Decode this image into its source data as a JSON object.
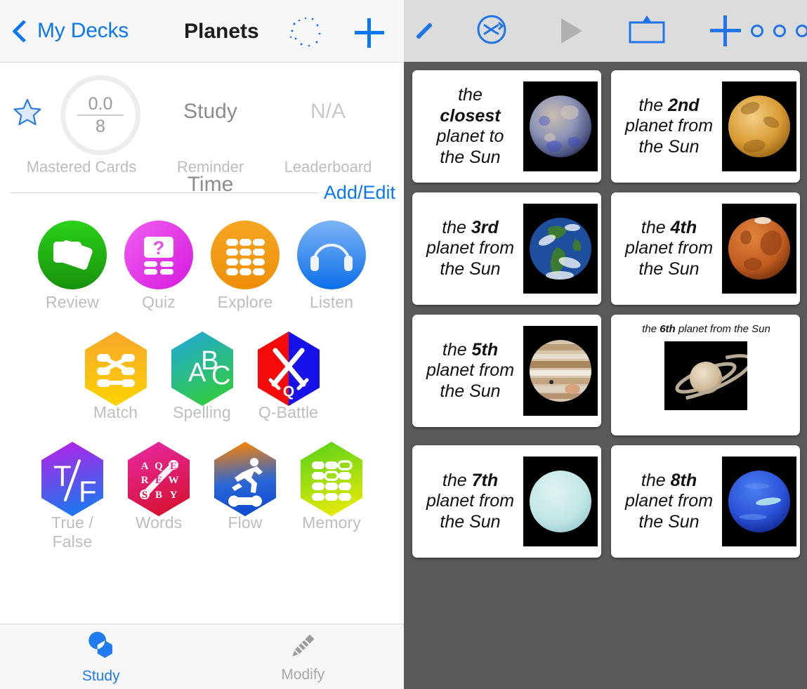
{
  "left": {
    "navbar": {
      "back_label": "My Decks",
      "title": "Planets",
      "night_icon": "moon-stars-icon",
      "add_icon": "plus-icon"
    },
    "stats": [
      {
        "caption": "Mastered Cards",
        "numerator": "0.0",
        "denominator": "8",
        "star_icon": "star-icon"
      },
      {
        "caption": "Reminder",
        "value": "Study Time"
      },
      {
        "caption": "Leaderboard",
        "value": "N/A"
      }
    ],
    "add_edit_label": "Add/Edit",
    "mode_rows": [
      [
        {
          "label": "Review",
          "icon": "review-cards-icon",
          "shape": "circle"
        },
        {
          "label": "Quiz",
          "icon": "quiz-question-icon",
          "shape": "circle"
        },
        {
          "label": "Explore",
          "icon": "explore-grid-icon",
          "shape": "circle"
        },
        {
          "label": "Listen",
          "icon": "headphones-icon",
          "shape": "circle"
        }
      ],
      [
        {
          "label": "Match",
          "icon": "match-nodes-icon",
          "shape": "hex"
        },
        {
          "label": "Spelling",
          "icon": "abc-icon",
          "shape": "hex"
        },
        {
          "label": "Q-Battle",
          "icon": "crossed-swords-icon",
          "shape": "hex"
        }
      ],
      [
        {
          "label": "True / False",
          "icon": "true-false-icon",
          "shape": "hex"
        },
        {
          "label": "Words",
          "icon": "word-search-icon",
          "shape": "hex"
        },
        {
          "label": "Flow",
          "icon": "runner-icon",
          "shape": "hex"
        },
        {
          "label": "Memory",
          "icon": "memory-grid-icon",
          "shape": "hex"
        }
      ]
    ],
    "tabs": [
      {
        "label": "Study",
        "icon": "study-shapes-icon",
        "active": true
      },
      {
        "label": "Modify",
        "icon": "pencil-icon",
        "active": false
      }
    ]
  },
  "right": {
    "toolbar": [
      {
        "name": "back-button",
        "icon": "chevron-left-icon"
      },
      {
        "name": "shuffle-button",
        "icon": "shuffle-icon"
      },
      {
        "name": "play-button",
        "icon": "play-icon"
      },
      {
        "name": "flip-button",
        "icon": "flip-card-icon"
      },
      {
        "name": "add-card-button",
        "icon": "plus-icon"
      },
      {
        "name": "more-button",
        "icon": "more-dots-icon"
      }
    ],
    "cards": [
      {
        "line1": "the",
        "bold": "closest",
        "line2": "planet to",
        "line3": "the Sun",
        "planet": "mercury",
        "layout": "side"
      },
      {
        "line1": "the",
        "bold": "2nd",
        "line2": "planet from",
        "line3": "the Sun",
        "planet": "venus",
        "layout": "side"
      },
      {
        "line1": "the",
        "bold": "3rd",
        "line2": "planet from",
        "line3": "the Sun",
        "planet": "earth",
        "layout": "side"
      },
      {
        "line1": "the",
        "bold": "4th",
        "line2": "planet from",
        "line3": "the Sun",
        "planet": "mars",
        "layout": "side"
      },
      {
        "line1": "the",
        "bold": "5th",
        "line2": "planet from",
        "line3": "the Sun",
        "planet": "jupiter",
        "layout": "side"
      },
      {
        "line1": "the",
        "bold": "6th",
        "line2": "planet from the Sun",
        "line3": "",
        "planet": "saturn",
        "layout": "stacked"
      },
      {
        "line1": "the",
        "bold": "7th",
        "line2": "planet from",
        "line3": "the Sun",
        "planet": "uranus",
        "layout": "side"
      },
      {
        "line1": "the",
        "bold": "8th",
        "line2": "planet from",
        "line3": "the Sun",
        "planet": "neptune",
        "layout": "side"
      }
    ]
  },
  "colors": {
    "accent_blue": "#0a77f2",
    "toolbar_blue": "#1e74e8",
    "muted_gray": "#bdbdbd",
    "navbar_bg": "#f7f7f7",
    "right_bg": "#595959",
    "right_toolbar_bg": "#dcdcdc"
  }
}
